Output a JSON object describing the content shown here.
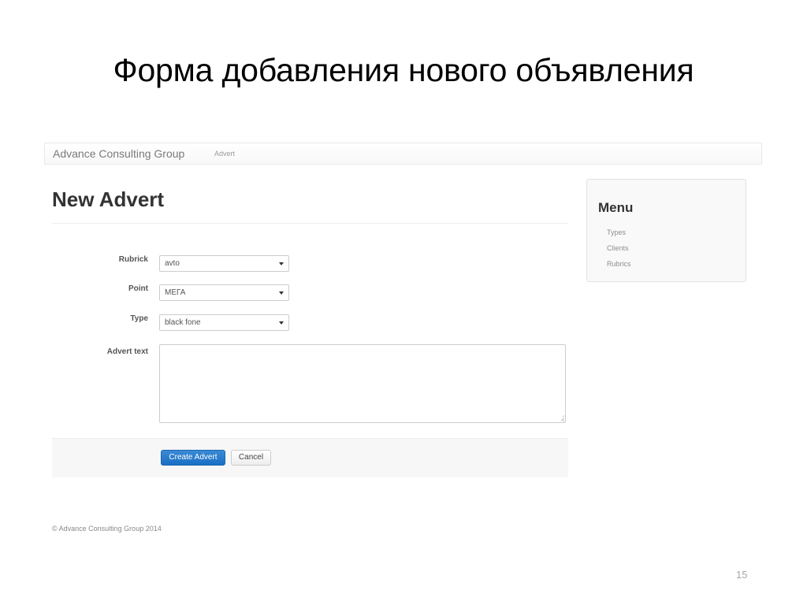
{
  "slide": {
    "title": "Форма добавления нового объявления",
    "page_number": "15"
  },
  "navbar": {
    "brand": "Advance Consulting Group",
    "links": [
      {
        "label": "Advert"
      }
    ]
  },
  "main": {
    "heading": "New Advert",
    "form": {
      "fields": [
        {
          "label": "Rubrick",
          "type": "select",
          "value": "avto"
        },
        {
          "label": "Point",
          "type": "select",
          "value": "МЕГА"
        },
        {
          "label": "Type",
          "type": "select",
          "value": "black fone"
        },
        {
          "label": "Advert text",
          "type": "textarea",
          "value": "",
          "placeholder": ""
        }
      ],
      "submit_label": "Create Advert",
      "cancel_label": "Cancel"
    }
  },
  "sidebar": {
    "title": "Menu",
    "items": [
      {
        "label": "Types"
      },
      {
        "label": "Clients"
      },
      {
        "label": "Rubrics"
      }
    ]
  },
  "footer": {
    "copyright": "© Advance Consulting Group 2014"
  },
  "colors": {
    "primary_button": "#1a6fc4",
    "heading_text": "#333333",
    "muted_text": "#8d8d8d",
    "panel_bg": "#f9f9f9",
    "navbar_bg": "#f8f8f8"
  }
}
